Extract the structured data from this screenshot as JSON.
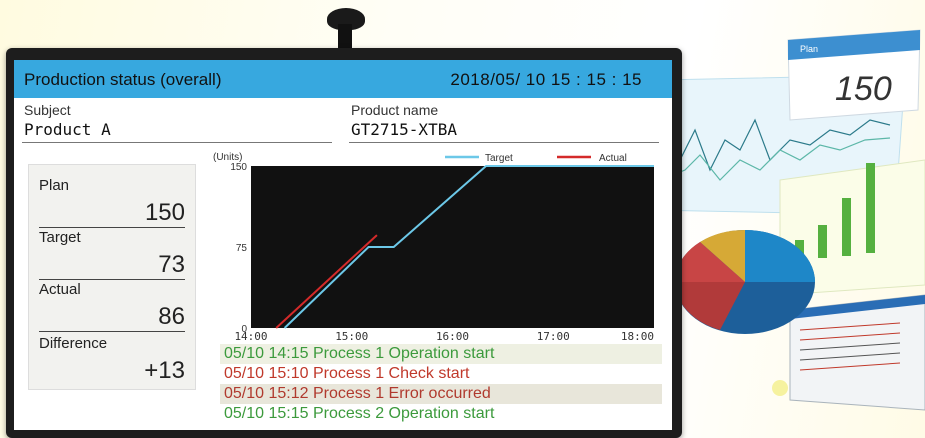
{
  "header": {
    "title": "Production status (overall)",
    "datetime": "2018/05/ 10  15 : 15 : 15"
  },
  "subject": {
    "label": "Subject",
    "value": "Product  A"
  },
  "product": {
    "label": "Product name",
    "value": "GT2715-XTBA"
  },
  "summary": [
    {
      "label": "Plan",
      "value": "150"
    },
    {
      "label": "Target",
      "value": "73"
    },
    {
      "label": "Actual",
      "value": "86"
    },
    {
      "label": "Difference",
      "value": "+13"
    }
  ],
  "chart_data": {
    "type": "line",
    "ylabel": "(Units)",
    "xlim": [
      "14:00",
      "18:00"
    ],
    "ylim": [
      0,
      150
    ],
    "x_ticks": [
      "14:00",
      "15:00",
      "16:00",
      "17:00",
      "18:00"
    ],
    "y_ticks": [
      "150",
      "75",
      "0"
    ],
    "grid": false,
    "legend_position": "top-right",
    "series": [
      {
        "name": "Target",
        "color": "#6cc8e8",
        "points": [
          [
            "14:20",
            0
          ],
          [
            "15:10",
            75
          ],
          [
            "15:25",
            75
          ],
          [
            "16:20",
            150
          ],
          [
            "18:00",
            150
          ]
        ]
      },
      {
        "name": "Actual",
        "color": "#d42a2a",
        "points": [
          [
            "14:15",
            0
          ],
          [
            "15:15",
            86
          ]
        ]
      }
    ]
  },
  "log": [
    {
      "text": "05/10  14:15 Process 1  Operation start",
      "color": "#3c9a3c",
      "bg": "#eef0e2"
    },
    {
      "text": "05/10  15:10 Process 1  Check start",
      "color": "#c0392b",
      "bg": "#ffffff"
    },
    {
      "text": "05/10  15:12 Process 1  Error occurred",
      "color": "#b03a2e",
      "bg": "#e8e6da"
    },
    {
      "text": "05/10  15:15 Process 2  Operation start",
      "color": "#3c9a3c",
      "bg": "#ffffff"
    }
  ],
  "decor": {
    "plan_card_label": "Plan",
    "plan_card_value": "150"
  }
}
